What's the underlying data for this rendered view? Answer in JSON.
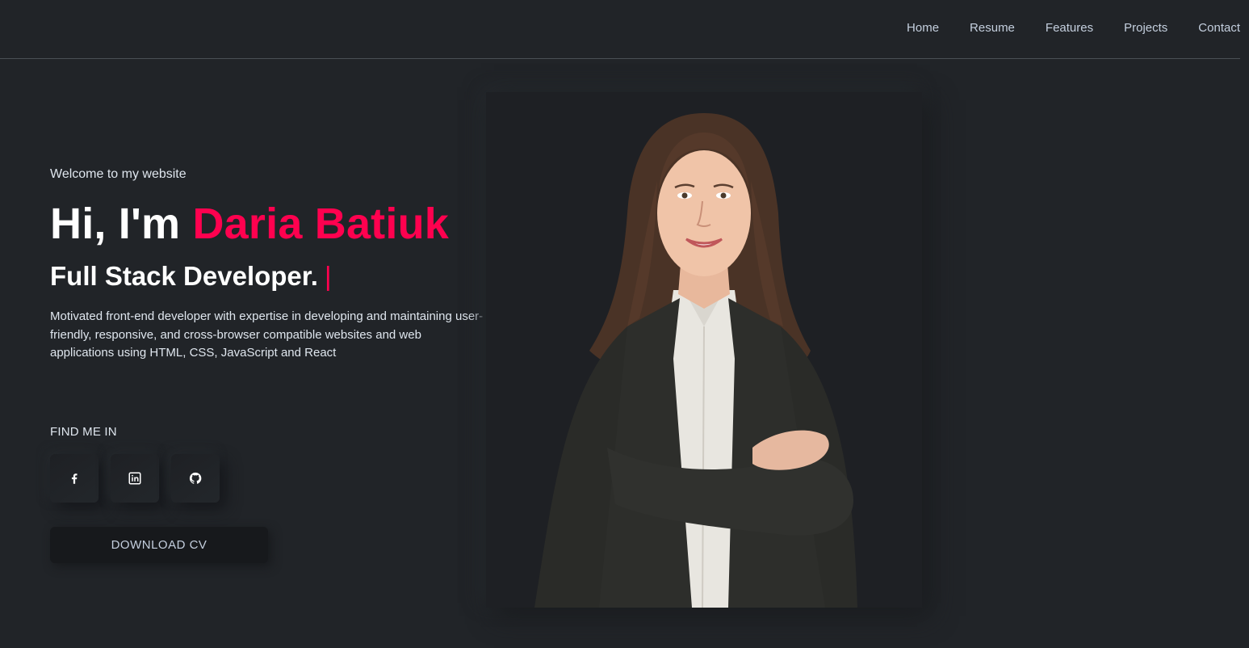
{
  "nav": {
    "items": [
      "Home",
      "Resume",
      "Features",
      "Projects",
      "Contact"
    ]
  },
  "hero": {
    "welcome": "Welcome to my website",
    "greeting": "Hi, I'm ",
    "name": "Daria Batiuk",
    "role": "Full Stack Developer.",
    "cursor": "|",
    "description": "Motivated front-end developer with expertise in developing and maintaining user-friendly, responsive, and cross-browser compatible websites and web applications using HTML, CSS, JavaScript and React",
    "find_me": "FIND ME IN",
    "socials": [
      {
        "icon": "facebook-icon"
      },
      {
        "icon": "linkedin-icon"
      },
      {
        "icon": "github-icon"
      }
    ],
    "download_label": "DOWNLOAD CV"
  },
  "colors": {
    "background": "#212428",
    "accent": "#ff014f",
    "text": "#c4cfde"
  }
}
